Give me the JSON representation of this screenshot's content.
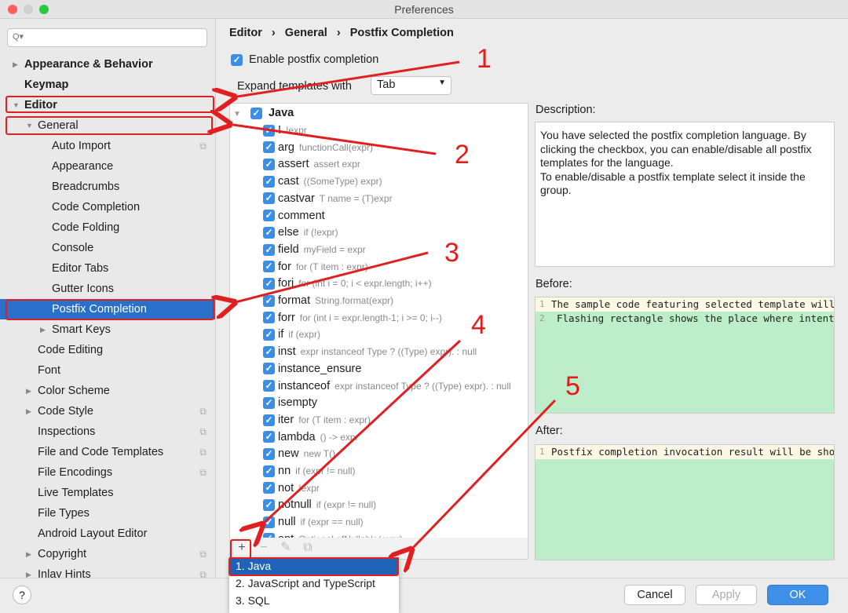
{
  "window": {
    "title": "Preferences"
  },
  "search": {
    "placeholder": "Q▾"
  },
  "sidebar": {
    "items": [
      {
        "label": "Appearance & Behavior",
        "level": 0,
        "bold": true,
        "arrow": "right"
      },
      {
        "label": "Keymap",
        "level": 0,
        "bold": true
      },
      {
        "label": "Editor",
        "level": 0,
        "bold": true,
        "arrow": "down"
      },
      {
        "label": "General",
        "level": 1,
        "arrow": "down"
      },
      {
        "label": "Auto Import",
        "level": 2,
        "copy": true
      },
      {
        "label": "Appearance",
        "level": 2
      },
      {
        "label": "Breadcrumbs",
        "level": 2
      },
      {
        "label": "Code Completion",
        "level": 2
      },
      {
        "label": "Code Folding",
        "level": 2
      },
      {
        "label": "Console",
        "level": 2
      },
      {
        "label": "Editor Tabs",
        "level": 2
      },
      {
        "label": "Gutter Icons",
        "level": 2
      },
      {
        "label": "Postfix Completion",
        "level": 2,
        "selected": true
      },
      {
        "label": "Smart Keys",
        "level": 2,
        "arrow": "right"
      },
      {
        "label": "Code Editing",
        "level": 1
      },
      {
        "label": "Font",
        "level": 1
      },
      {
        "label": "Color Scheme",
        "level": 1,
        "arrow": "right"
      },
      {
        "label": "Code Style",
        "level": 1,
        "arrow": "right",
        "copy": true
      },
      {
        "label": "Inspections",
        "level": 1,
        "copy": true
      },
      {
        "label": "File and Code Templates",
        "level": 1,
        "copy": true
      },
      {
        "label": "File Encodings",
        "level": 1,
        "copy": true
      },
      {
        "label": "Live Templates",
        "level": 1
      },
      {
        "label": "File Types",
        "level": 1
      },
      {
        "label": "Android Layout Editor",
        "level": 1
      },
      {
        "label": "Copyright",
        "level": 1,
        "arrow": "right",
        "copy": true
      },
      {
        "label": "Inlay Hints",
        "level": 1,
        "arrow": "right",
        "copy": true
      }
    ]
  },
  "breadcrumb": [
    "Editor",
    "General",
    "Postfix Completion"
  ],
  "enable_label": "Enable postfix completion",
  "expand_label": "Expand templates with",
  "expand_value": "Tab",
  "tree": {
    "group": "Java",
    "templates": [
      {
        "key": "!",
        "hint": "!expr"
      },
      {
        "key": "arg",
        "hint": "functionCall(expr)"
      },
      {
        "key": "assert",
        "hint": "assert expr"
      },
      {
        "key": "cast",
        "hint": "((SomeType) expr)"
      },
      {
        "key": "castvar",
        "hint": "T name = (T)expr"
      },
      {
        "key": "comment",
        "hint": ""
      },
      {
        "key": "else",
        "hint": "if (!expr)"
      },
      {
        "key": "field",
        "hint": "myField = expr"
      },
      {
        "key": "for",
        "hint": "for (T item : expr)"
      },
      {
        "key": "fori",
        "hint": "for (int i = 0; i < expr.length; i++)"
      },
      {
        "key": "format",
        "hint": "String.format(expr)"
      },
      {
        "key": "forr",
        "hint": "for (int i = expr.length-1; i >= 0; i--)"
      },
      {
        "key": "if",
        "hint": "if (expr)"
      },
      {
        "key": "inst",
        "hint": "expr instanceof Type ? ((Type) expr). : null"
      },
      {
        "key": "instance_ensure",
        "hint": ""
      },
      {
        "key": "instanceof",
        "hint": "expr instanceof Type ? ((Type) expr). : null"
      },
      {
        "key": "isempty",
        "hint": ""
      },
      {
        "key": "iter",
        "hint": "for (T item : expr)"
      },
      {
        "key": "lambda",
        "hint": "() -> expr"
      },
      {
        "key": "new",
        "hint": "new T()"
      },
      {
        "key": "nn",
        "hint": "if (expr != null)"
      },
      {
        "key": "not",
        "hint": "!expr"
      },
      {
        "key": "notnull",
        "hint": "if (expr != null)"
      },
      {
        "key": "null",
        "hint": "if (expr == null)"
      },
      {
        "key": "opt",
        "hint": "Optional.ofNullable(expr)"
      }
    ]
  },
  "popup": [
    "1. Java",
    "2. JavaScript and TypeScript",
    "3. SQL"
  ],
  "description": {
    "label": "Description:",
    "text": "You have selected the postfix completion language. By clicking the checkbox, you can enable/disable all postfix templates for the language.\nTo enable/disable a postfix template select it inside the group."
  },
  "before": {
    "label": "Before:",
    "lines": [
      "The sample code featuring selected template will",
      "Flashing rectangle shows the place where intent"
    ]
  },
  "after": {
    "label": "After:",
    "lines": [
      "Postfix completion invocation result will be sho"
    ]
  },
  "buttons": {
    "cancel": "Cancel",
    "apply": "Apply",
    "ok": "OK",
    "help": "?"
  },
  "annotations": [
    "1",
    "2",
    "3",
    "4",
    "5"
  ],
  "colors": {
    "accent": "#2a6fc9",
    "annotation": "#e21b1b",
    "preview_bg": "#bdeec9"
  }
}
